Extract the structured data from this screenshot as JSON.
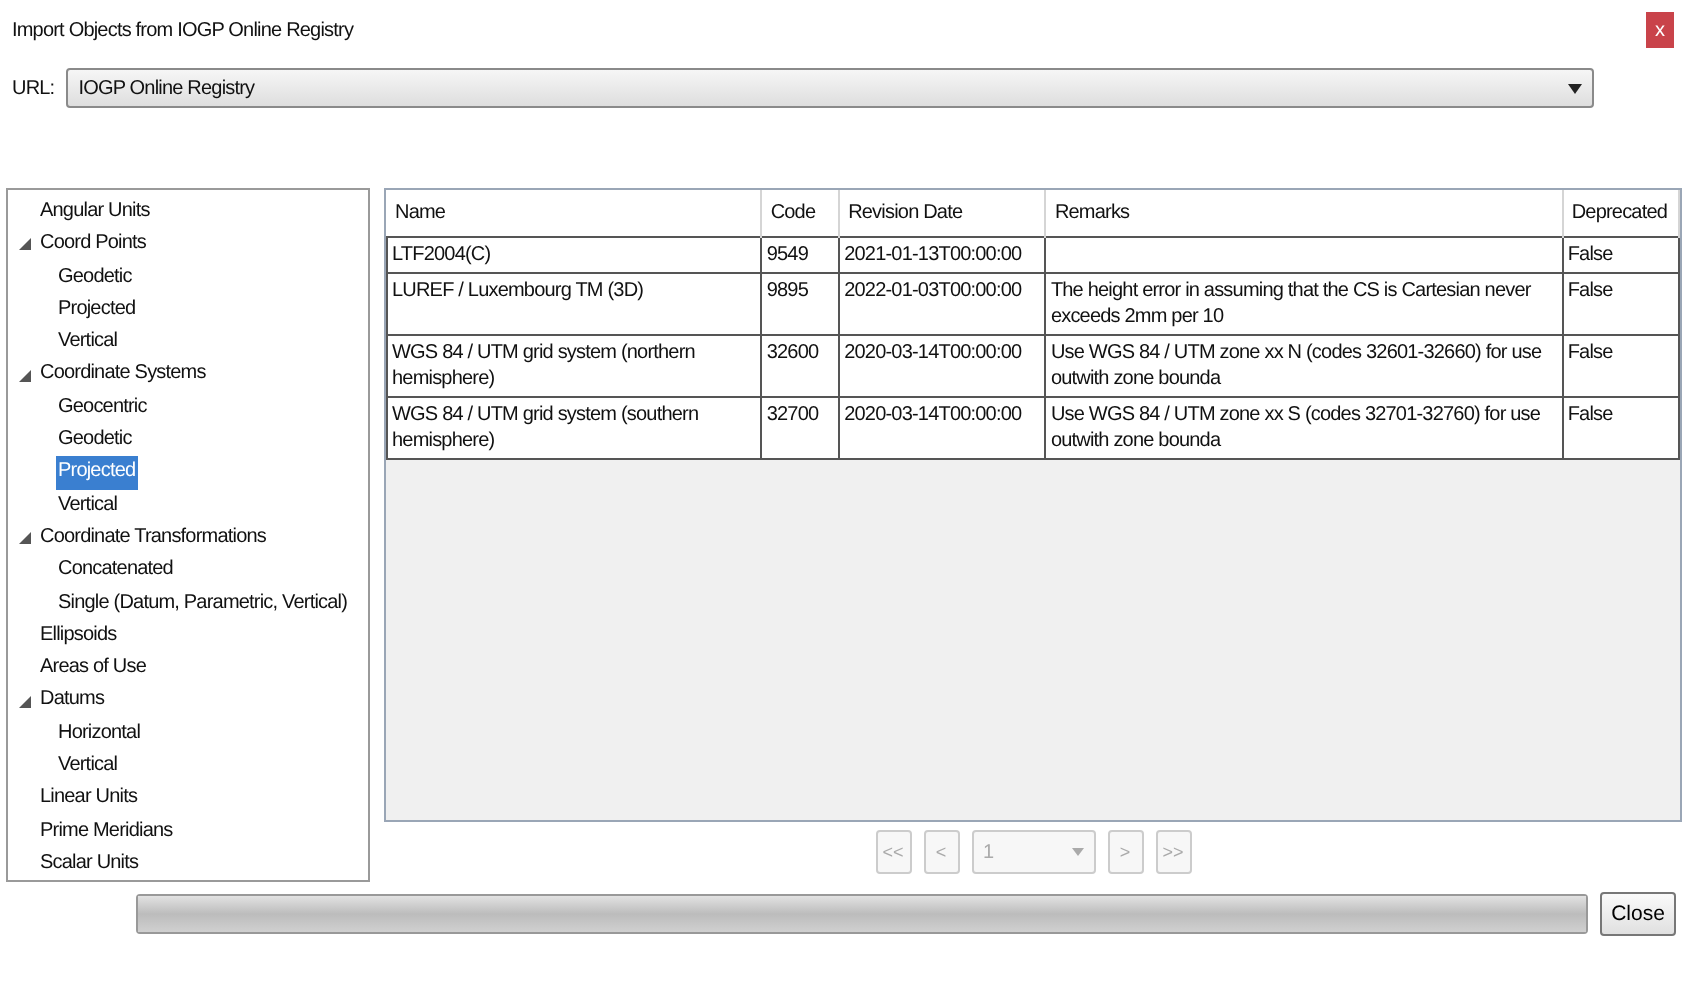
{
  "window": {
    "title": "Import Objects from IOGP Online Registry",
    "close": "x"
  },
  "url": {
    "label": "URL:",
    "value": "IOGP Online Registry"
  },
  "tree": [
    {
      "label": "Angular Units",
      "selected": false
    },
    {
      "label": "Coord Points",
      "selected": false,
      "expanded": true,
      "children": [
        {
          "label": "Geodetic",
          "selected": false
        },
        {
          "label": "Projected",
          "selected": false
        },
        {
          "label": "Vertical",
          "selected": false
        }
      ]
    },
    {
      "label": "Coordinate Systems",
      "selected": false,
      "expanded": true,
      "children": [
        {
          "label": "Geocentric",
          "selected": false
        },
        {
          "label": "Geodetic",
          "selected": false
        },
        {
          "label": "Projected",
          "selected": true
        },
        {
          "label": "Vertical",
          "selected": false
        }
      ]
    },
    {
      "label": "Coordinate Transformations",
      "selected": false,
      "expanded": true,
      "children": [
        {
          "label": "Concatenated",
          "selected": false
        },
        {
          "label": "Single (Datum, Parametric, Vertical)",
          "selected": false
        }
      ]
    },
    {
      "label": "Ellipsoids",
      "selected": false
    },
    {
      "label": "Areas of Use",
      "selected": false
    },
    {
      "label": "Datums",
      "selected": false,
      "expanded": true,
      "children": [
        {
          "label": "Horizontal",
          "selected": false
        },
        {
          "label": "Vertical",
          "selected": false
        }
      ]
    },
    {
      "label": "Linear Units",
      "selected": false
    },
    {
      "label": "Prime Meridians",
      "selected": false
    },
    {
      "label": "Scalar Units",
      "selected": false
    }
  ],
  "table": {
    "columns": [
      "Name",
      "Code",
      "Revision Date",
      "Remarks",
      "Deprecated"
    ],
    "rows": [
      [
        "LTF2004(C)",
        "9549",
        "2021-01-13T00:00:00",
        "",
        "False"
      ],
      [
        "LUREF / Luxembourg TM (3D)",
        "9895",
        "2022-01-03T00:00:00",
        "The height error in assuming that the CS is Cartesian never exceeds 2mm per 10",
        "False"
      ],
      [
        "WGS 84 / UTM grid system (northern hemisphere)",
        "32600",
        "2020-03-14T00:00:00",
        "Use WGS 84 / UTM zone xx N (codes 32601-32660) for use outwith zone bounda",
        "False"
      ],
      [
        "WGS 84 / UTM grid system (southern hemisphere)",
        "32700",
        "2020-03-14T00:00:00",
        "Use WGS 84 / UTM zone xx S (codes 32701-32760) for use outwith zone bounda",
        "False"
      ]
    ]
  },
  "pager": {
    "first": "<<",
    "prev": "<",
    "page": "1",
    "next": ">",
    "last": ">>",
    "disabled": true
  },
  "progress": {
    "level": 1
  },
  "close_button": "Close"
}
